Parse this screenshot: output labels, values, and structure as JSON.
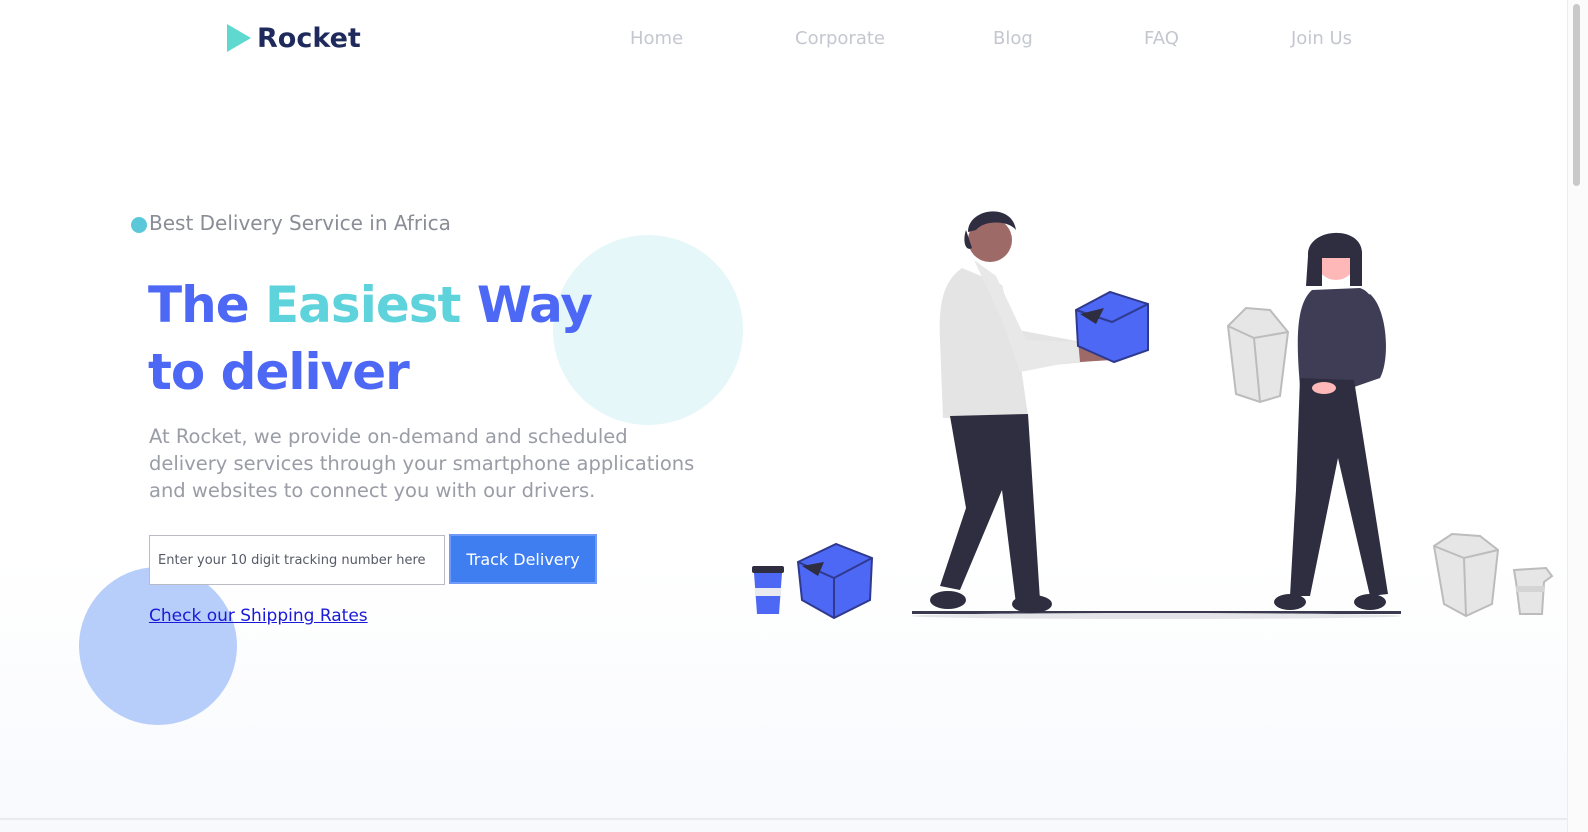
{
  "brand": {
    "name": "Rocket",
    "logo_icon": "play-triangle-icon",
    "colors": {
      "mark": "#5fd9cf",
      "text": "#1f2a5c"
    }
  },
  "nav": {
    "items": [
      {
        "label": "Home"
      },
      {
        "label": "Corporate"
      },
      {
        "label": "Blog"
      },
      {
        "label": "FAQ"
      },
      {
        "label": "Join Us"
      }
    ]
  },
  "hero": {
    "tagline": "Best Delivery Service in Africa",
    "headline": {
      "part1": "The ",
      "accent": "Easiest",
      "part2": " Way",
      "line2": "to deliver"
    },
    "description": "At Rocket, we provide on-demand and scheduled delivery services through your smartphone applications and websites to connect you with our drivers.",
    "tracking": {
      "placeholder": "Enter your 10 digit tracking number here",
      "value": "",
      "button_label": "Track Delivery"
    },
    "rates_link": "Check our Shipping Rates",
    "illustration": "people-exchanging-delivery-boxes-illustration"
  },
  "colors": {
    "primary": "#4d68f5",
    "accent": "#5fd3dc",
    "button": "#3f7ef0",
    "link": "#1a1ad8",
    "muted_text": "#9a9ca6",
    "nav_text": "#c4c7cf"
  }
}
